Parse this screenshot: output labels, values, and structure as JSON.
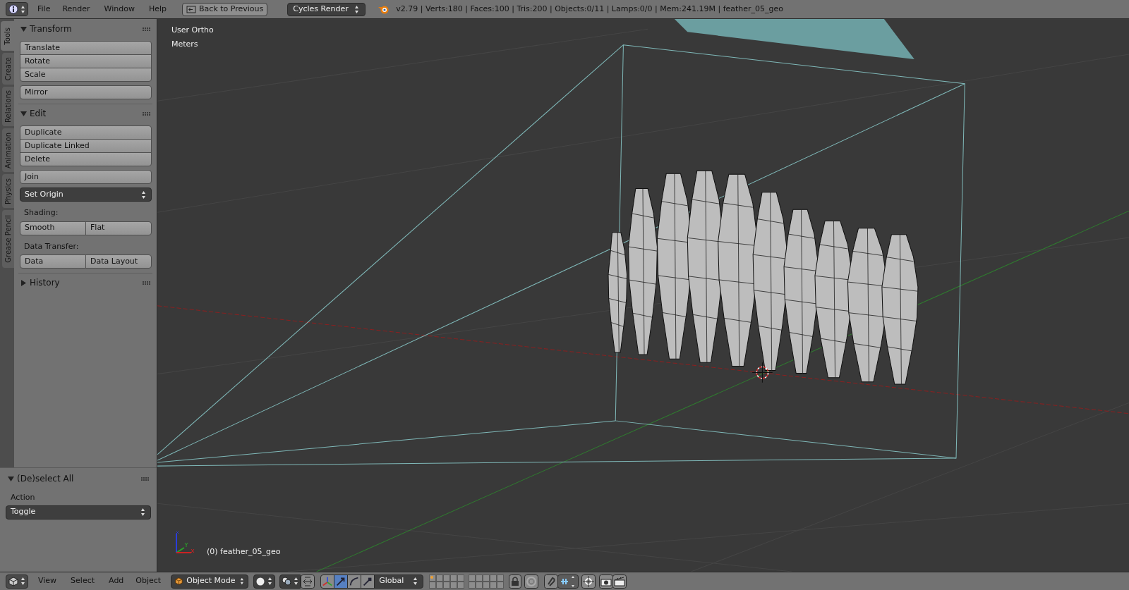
{
  "top_bar": {
    "menus": [
      "File",
      "Render",
      "Window",
      "Help"
    ],
    "back_button": "Back to Previous",
    "render_engine": "Cycles Render",
    "stats": "v2.79 | Verts:180 | Faces:100 | Tris:200 | Objects:0/11 | Lamps:0/0 | Mem:241.19M | feather_05_geo"
  },
  "tool_shelf": {
    "tabs": [
      {
        "label": "Tools",
        "selected": true
      },
      {
        "label": "Create",
        "selected": false
      },
      {
        "label": "Relations",
        "selected": false
      },
      {
        "label": "Animation",
        "selected": false
      },
      {
        "label": "Physics",
        "selected": false
      },
      {
        "label": "Grease Pencil",
        "selected": false
      }
    ],
    "panels": [
      {
        "title": "Transform",
        "expanded": true,
        "rows": [
          {
            "kind": "column",
            "items": [
              "Translate",
              "Rotate",
              "Scale"
            ]
          },
          {
            "kind": "button",
            "text": "Mirror"
          }
        ]
      },
      {
        "title": "Edit",
        "expanded": true,
        "rows": [
          {
            "kind": "column",
            "items": [
              "Duplicate",
              "Duplicate Linked",
              "Delete"
            ]
          },
          {
            "kind": "button",
            "text": "Join"
          },
          {
            "kind": "dropdown",
            "text": "Set Origin"
          },
          {
            "kind": "label",
            "text": "Shading:"
          },
          {
            "kind": "row",
            "items": [
              "Smooth",
              "Flat"
            ]
          },
          {
            "kind": "label",
            "text": "Data Transfer:"
          },
          {
            "kind": "row",
            "items": [
              "Data",
              "Data Layout"
            ]
          }
        ]
      },
      {
        "title": "History",
        "expanded": false
      }
    ]
  },
  "redo_panel": {
    "title": "(De)select All",
    "expanded": true,
    "label": "Action",
    "value": "Toggle"
  },
  "viewport": {
    "view_name": "User Ortho",
    "units": "Meters",
    "object_label": "(0) feather_05_geo"
  },
  "bottom_bar": {
    "menus": [
      "View",
      "Select",
      "Add",
      "Object"
    ],
    "mode": "Object Mode",
    "manipulators": [
      {
        "kind": "axes",
        "selected": false
      },
      {
        "kind": "translate",
        "selected": true
      },
      {
        "kind": "rotate",
        "selected": false
      },
      {
        "kind": "scale",
        "selected": false
      }
    ],
    "orientation": "Global",
    "layers": [
      {
        "occupied": true
      },
      {
        "occupied": false
      },
      {
        "occupied": false
      },
      {
        "occupied": false
      },
      {
        "occupied": false
      },
      {
        "occupied": false
      },
      {
        "occupied": false
      },
      {
        "occupied": false
      },
      {
        "occupied": false
      },
      {
        "occupied": false
      },
      {
        "occupied": false
      },
      {
        "occupied": false
      },
      {
        "occupied": false
      },
      {
        "occupied": false
      },
      {
        "occupied": false
      },
      {
        "occupied": false
      },
      {
        "occupied": false
      },
      {
        "occupied": false
      },
      {
        "occupied": false
      },
      {
        "occupied": false
      }
    ]
  }
}
